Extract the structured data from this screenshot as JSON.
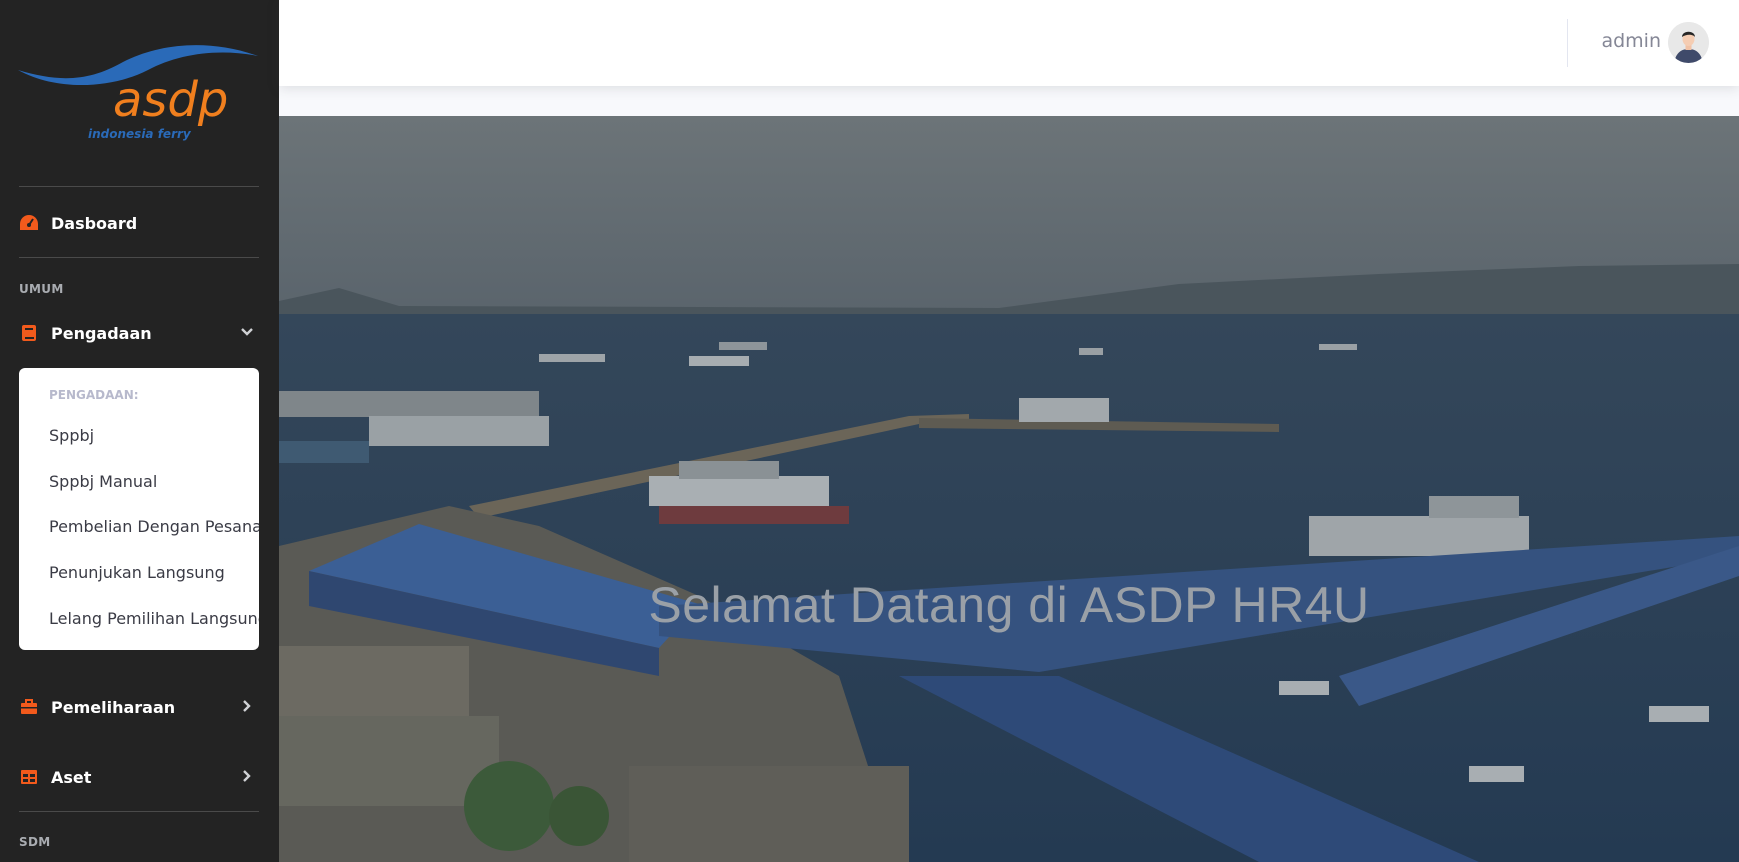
{
  "brand": {
    "logo_text": "asdp",
    "logo_tagline": "indonesia ferry",
    "colors": {
      "wave": "#2a6ab8",
      "text": "#f07f1e"
    }
  },
  "sidebar": {
    "dashboard_label": "Dasboard",
    "section_umum": "UMUM",
    "pengadaan_label": "Pengadaan",
    "submenu": {
      "heading": "PENGADAAN:",
      "items": [
        "Sppbj",
        "Sppbj Manual",
        "Pembelian Dengan Pesanan",
        "Penunjukan Langsung",
        "Lelang Pemilihan Langsung"
      ]
    },
    "pemeliharaan_label": "Pemeliharaan",
    "aset_label": "Aset",
    "section_sdm": "SDM",
    "icon_color": "#f25a1c"
  },
  "topbar": {
    "user_name": "admin"
  },
  "hero": {
    "title": "Selamat Datang di ASDP HR4U"
  }
}
